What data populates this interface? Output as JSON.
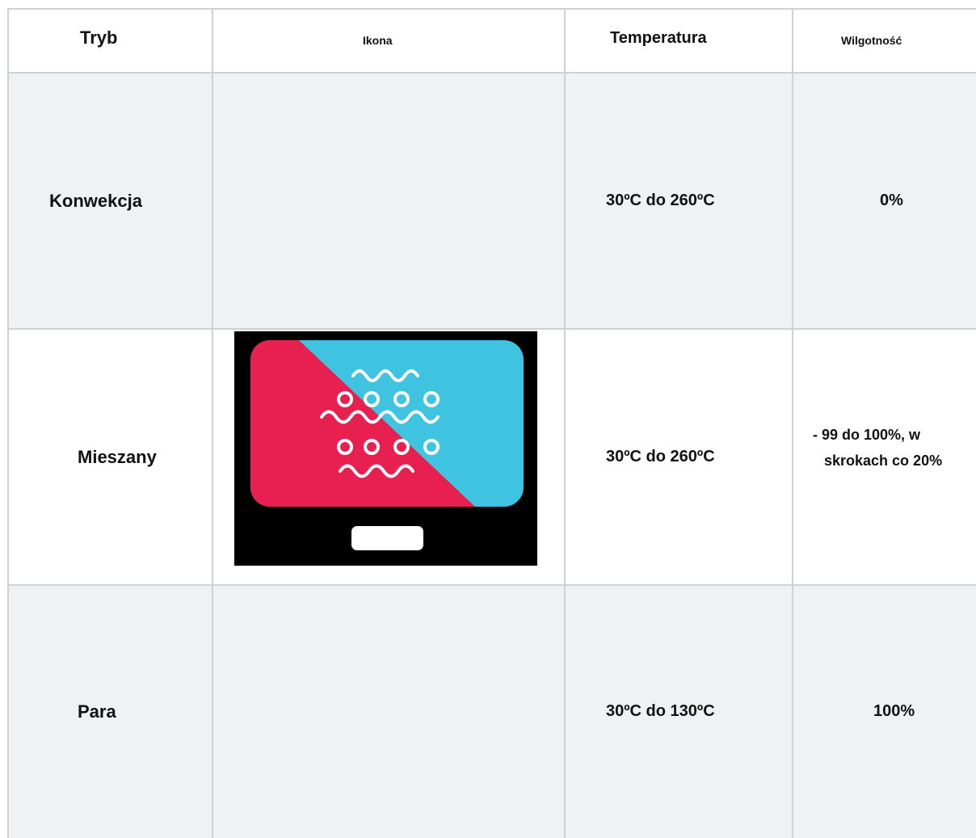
{
  "table": {
    "headers": {
      "mode": "Tryb",
      "icon": "Ikona",
      "temperature": "Temperatura",
      "humidity": "Wilgotność"
    },
    "rows": [
      {
        "mode": "Konwekcja",
        "temperature": "30ºC do 260ºC",
        "humidity": "0%"
      },
      {
        "mode": "Mieszany",
        "icon": "combi-steam-mode-icon",
        "temperature": "30ºC do 260ºC",
        "humidity_line1": "- 99 do 100%, w",
        "humidity_line2": "skrokach co 20%"
      },
      {
        "mode": "Para",
        "temperature": "30ºC do 130ºC",
        "humidity": "100%"
      }
    ],
    "colors": {
      "icon_red": "#e8204f",
      "icon_blue": "#3ec4e0",
      "icon_frame": "#000000"
    }
  }
}
